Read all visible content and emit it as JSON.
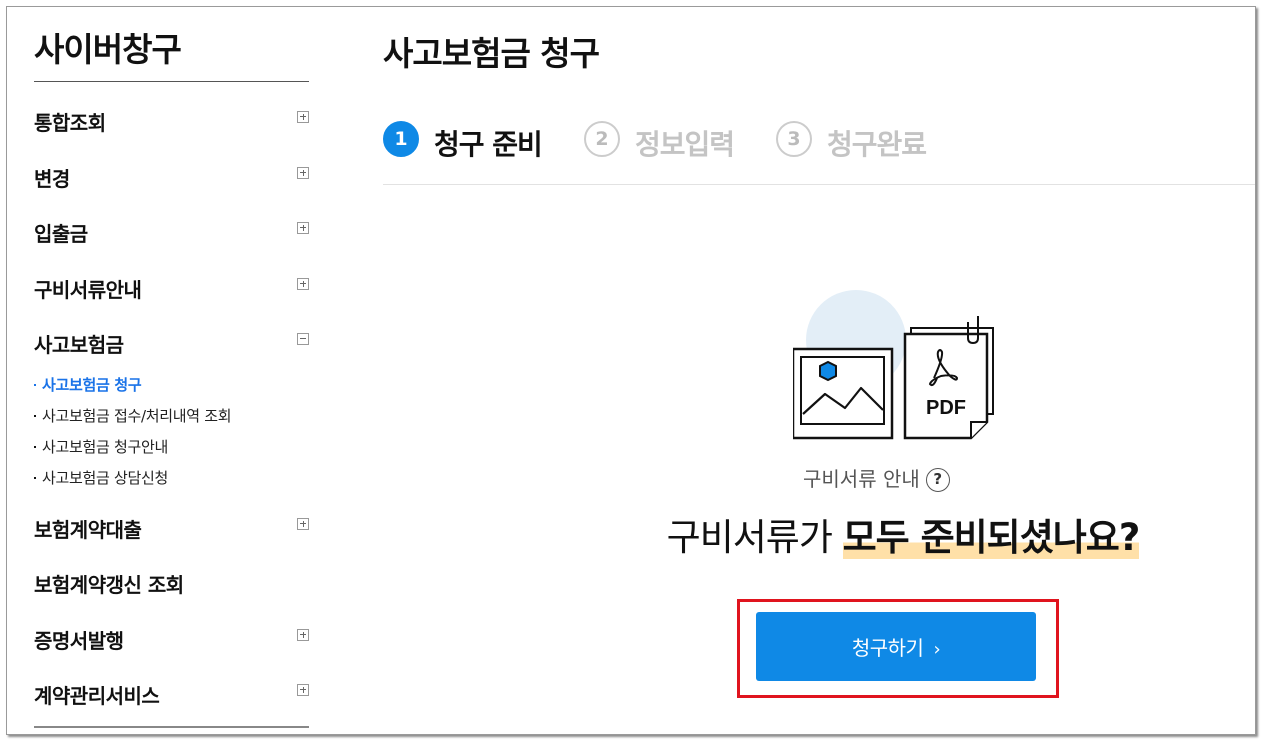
{
  "sidebar": {
    "title": "사이버창구",
    "menu": [
      {
        "label": "통합조회",
        "toggle": "plus"
      },
      {
        "label": "변경",
        "toggle": "plus"
      },
      {
        "label": "입출금",
        "toggle": "plus"
      },
      {
        "label": "구비서류안내",
        "toggle": "plus"
      },
      {
        "label": "사고보험금",
        "toggle": "minus"
      },
      {
        "label": "보험계약대출",
        "toggle": "plus"
      },
      {
        "label": "보험계약갱신 조회",
        "toggle": "none"
      },
      {
        "label": "증명서발행",
        "toggle": "plus"
      },
      {
        "label": "계약관리서비스",
        "toggle": "plus"
      }
    ],
    "submenu": [
      {
        "label": "사고보험금 청구",
        "active": true
      },
      {
        "label": "사고보험금 접수/처리내역 조회",
        "active": false
      },
      {
        "label": "사고보험금 청구안내",
        "active": false
      },
      {
        "label": "사고보험금 상담신청",
        "active": false
      }
    ]
  },
  "main": {
    "title": "사고보험금 청구",
    "steps": [
      {
        "num": "1",
        "label": "청구 준비",
        "active": true
      },
      {
        "num": "2",
        "label": "정보입력",
        "active": false
      },
      {
        "num": "3",
        "label": "청구완료",
        "active": false
      }
    ],
    "pdf_label": "PDF",
    "guide_text": "구비서류 안내",
    "guide_icon": "?",
    "headline_normal": "구비서류가 ",
    "headline_bold": "모두 준비되셨나요?",
    "cta_label": "청구하기",
    "cta_chevron": "›"
  },
  "colors": {
    "accent": "#0f89e6",
    "highlight": "#ffe0a8",
    "outline": "#e0141e",
    "active_sub": "#1a73e8"
  }
}
